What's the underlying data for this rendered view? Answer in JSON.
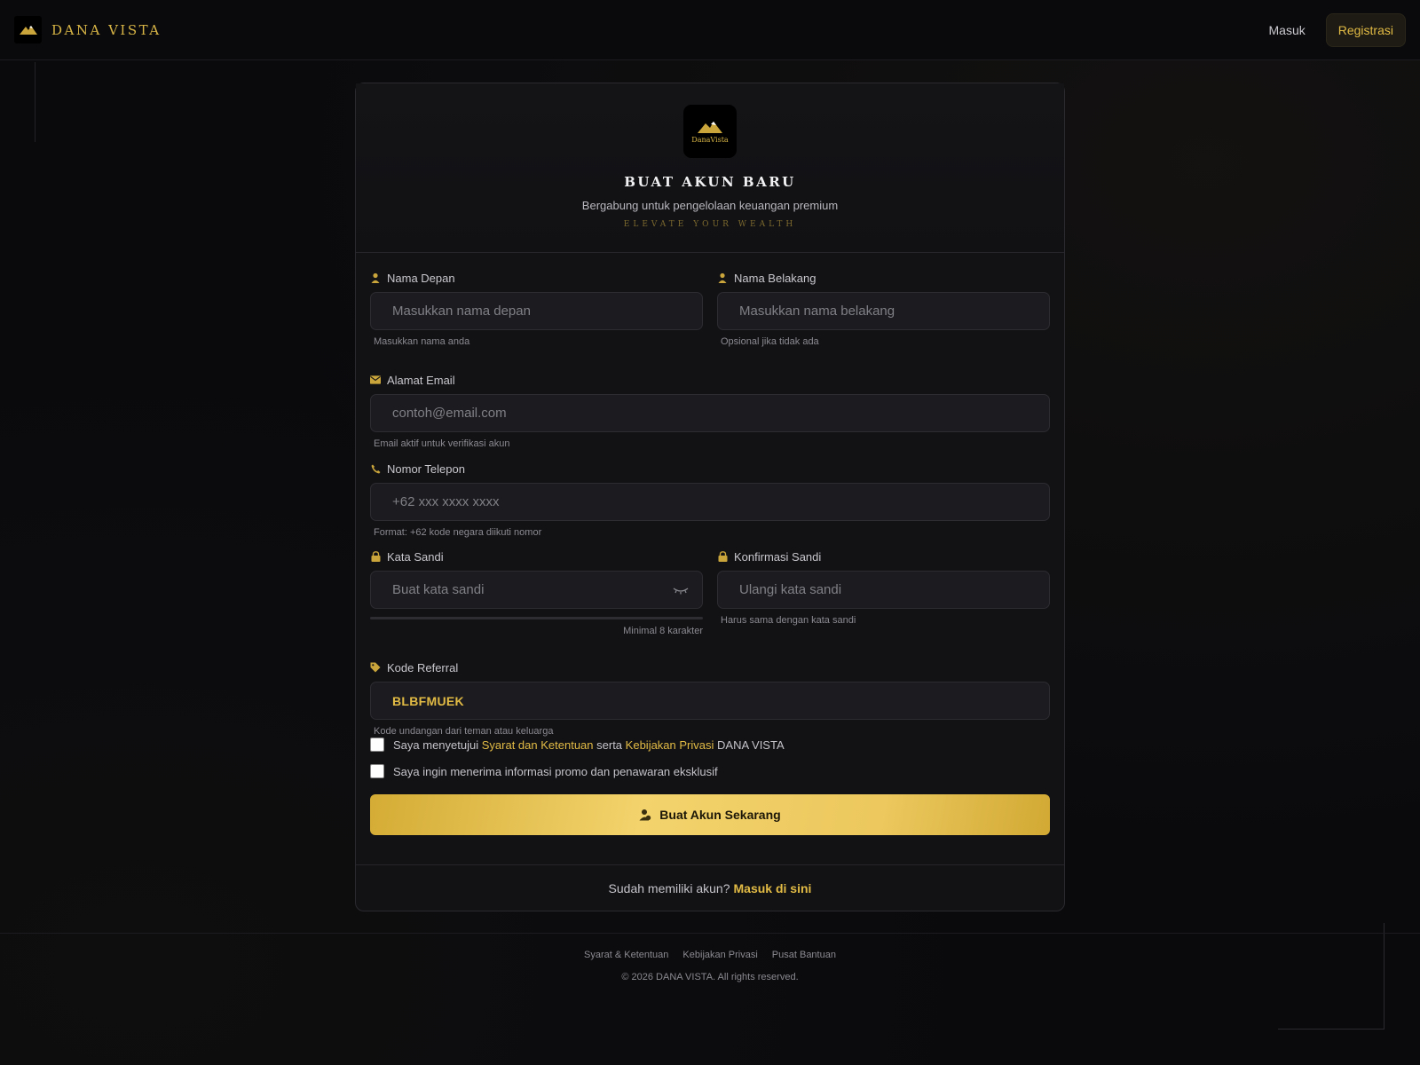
{
  "header": {
    "brand": "DANA VISTA",
    "login_label": "Masuk",
    "register_label": "Registrasi"
  },
  "card": {
    "logo_text": "DanaVista",
    "title": "BUAT AKUN BARU",
    "subtitle": "Bergabung untuk pengelolaan keuangan premium",
    "tagline": "ELEVATE YOUR WEALTH"
  },
  "form": {
    "first_name": {
      "label": "Nama Depan",
      "placeholder": "Masukkan nama depan",
      "hint": "Masukkan nama anda"
    },
    "last_name": {
      "label": "Nama Belakang",
      "placeholder": "Masukkan nama belakang",
      "hint": "Opsional jika tidak ada"
    },
    "email": {
      "label": "Alamat Email",
      "placeholder": "contoh@email.com",
      "hint": "Email aktif untuk verifikasi akun"
    },
    "phone": {
      "label": "Nomor Telepon",
      "placeholder": "+62 xxx xxxx xxxx",
      "hint": "Format: +62 kode negara diikuti nomor"
    },
    "password": {
      "label": "Kata Sandi",
      "placeholder": "Buat kata sandi",
      "hint": "Minimal 8 karakter"
    },
    "confirm": {
      "label": "Konfirmasi Sandi",
      "placeholder": "Ulangi kata sandi",
      "hint": "Harus sama dengan kata sandi"
    },
    "referral": {
      "label": "Kode Referral",
      "value": "BLBFMUEK",
      "hint": "Kode undangan dari teman atau keluarga"
    },
    "terms": {
      "prefix": "Saya menyetujui",
      "terms_link": "Syarat dan Ketentuan",
      "middle": "serta",
      "privacy_link": "Kebijakan Privasi",
      "suffix": "DANA VISTA"
    },
    "promo_label": "Saya ingin menerima informasi promo dan penawaran eksklusif",
    "submit_label": "Buat Akun Sekarang"
  },
  "card_footer": {
    "question": "Sudah memiliki akun?",
    "link": "Masuk di sini"
  },
  "footer": {
    "links": [
      "Syarat & Ketentuan",
      "Kebijakan Privasi",
      "Pusat Bantuan"
    ],
    "copyright": "© 2026 DANA VISTA. All rights reserved."
  },
  "colors": {
    "accent": "#e2bb45",
    "background": "#0a0a0d",
    "card": "#121215",
    "input": "#1c1c20"
  },
  "icons": {
    "first_name": "user-icon",
    "last_name": "user-icon",
    "email": "envelope-icon",
    "phone": "phone-icon",
    "password": "lock-icon",
    "confirm": "lock-icon",
    "referral": "tag-icon",
    "toggle": "eye-closed-icon",
    "submit": "user-add-icon"
  }
}
